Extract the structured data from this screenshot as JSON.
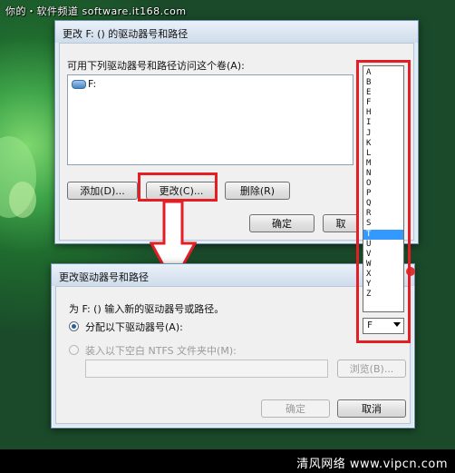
{
  "watermark_top": "你的・软件频道 software.it168.com",
  "watermark_bottom": "清风网络 www.vipcn.com",
  "dialog1": {
    "title": "更改 F: () 的驱动器号和路径",
    "prompt": "可用下列驱动器号和路径访问这个卷(A):",
    "list_item": "F:",
    "add_label": "添加(D)...",
    "change_label": "更改(C)...",
    "delete_label": "删除(R)",
    "ok_label": "确定",
    "cancel_partial": "取"
  },
  "dialog2": {
    "title": "更改驱动器号和路径",
    "instruction": "为 F: () 输入新的驱动器号或路径。",
    "option_assign": "分配以下驱动器号(A):",
    "option_mount": "装入以下空白 NTFS 文件夹中(M):",
    "browse_label": "浏览(B)...",
    "ok_label": "确定",
    "cancel_label": "取消"
  },
  "drive_letters": [
    "A",
    "B",
    "E",
    "F",
    "H",
    "I",
    "J",
    "K",
    "L",
    "M",
    "N",
    "O",
    "P",
    "Q",
    "R",
    "S",
    "T",
    "U",
    "V",
    "W",
    "X",
    "Y",
    "Z"
  ],
  "selected_letter": "T",
  "combo_value": "F",
  "colors": {
    "highlight_red": "#e31e24",
    "selection_blue": "#3399ff"
  }
}
